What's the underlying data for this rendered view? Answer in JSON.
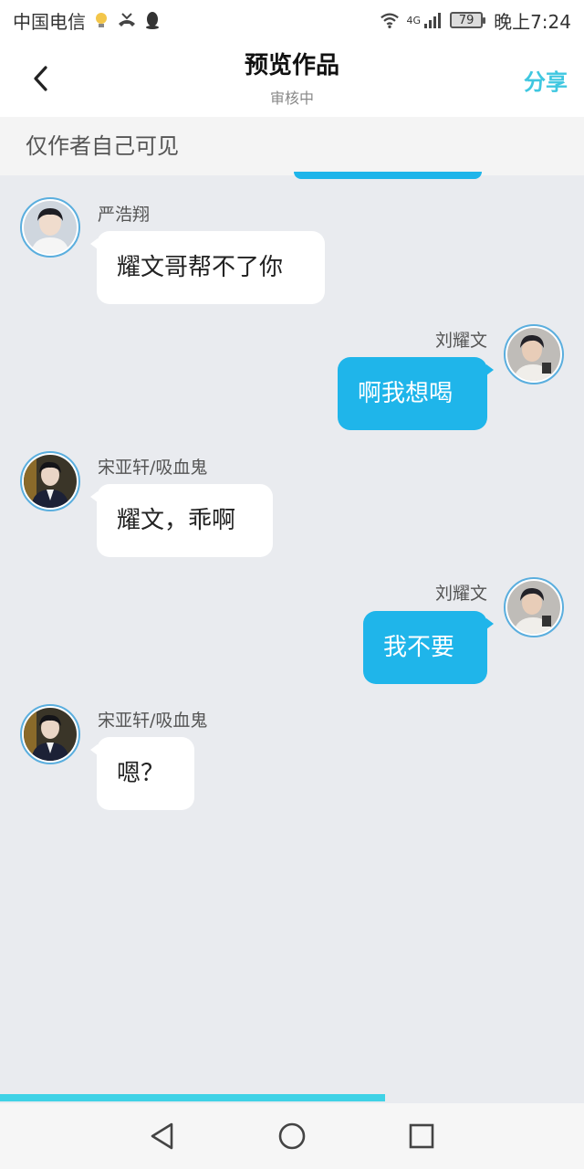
{
  "status_bar": {
    "carrier": "中国电信",
    "network": "4G",
    "battery": "79",
    "time": "晚上7:24"
  },
  "header": {
    "title": "预览作品",
    "subtitle": "审核中",
    "share_label": "分享"
  },
  "notice": "仅作者自己可见",
  "messages": [
    {
      "side": "left",
      "name": "严浩翔",
      "text": "耀文哥帮不了你"
    },
    {
      "side": "right",
      "name": "刘耀文",
      "text": "啊我想喝"
    },
    {
      "side": "left",
      "name": "宋亚轩/吸血鬼",
      "text": "耀文，乖啊"
    },
    {
      "side": "right",
      "name": "刘耀文",
      "text": "我不要"
    },
    {
      "side": "left",
      "name": "宋亚轩/吸血鬼",
      "text": "嗯？"
    }
  ],
  "progress": 0.66,
  "colors": {
    "accent": "#3fc7e0",
    "right_bubble": "#1fb5ea",
    "background": "#e9ebef"
  }
}
